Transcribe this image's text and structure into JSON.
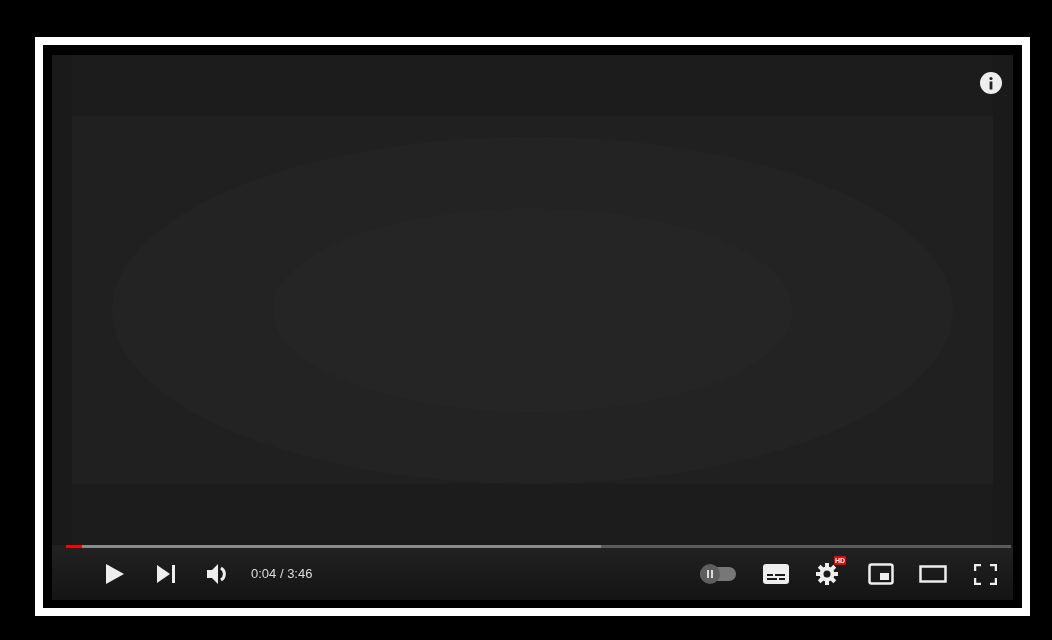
{
  "player": {
    "progress": {
      "level": 0.017
    },
    "buffered": {
      "level": 0.566
    },
    "time": "0:04 / 3:46",
    "autoplay": {
      "on": false
    },
    "settings_badge": "HD"
  }
}
